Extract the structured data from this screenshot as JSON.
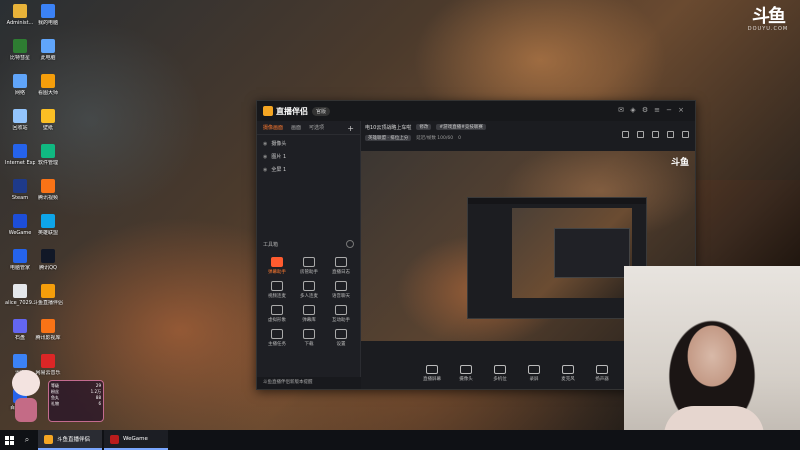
{
  "desktop": {
    "watermark": {
      "mark": "斗鱼",
      "sub": "DOUYU.COM"
    },
    "icons": [
      {
        "label": "Administ...",
        "color": "#e8b339"
      },
      {
        "label": "我的电脑",
        "color": "#3b82f6"
      },
      {
        "label": "比特彗星",
        "color": "#2e7d32"
      },
      {
        "label": "此电脑",
        "color": "#60a5fa"
      },
      {
        "label": "网络",
        "color": "#60a5fa"
      },
      {
        "label": "看图大师",
        "color": "#f59e0b"
      },
      {
        "label": "回收站",
        "color": "#93c5fd"
      },
      {
        "label": "壁纸",
        "color": "#fbbf24"
      },
      {
        "label": "Internet Explorer",
        "color": "#2563eb"
      },
      {
        "label": "软件管理",
        "color": "#10b981"
      },
      {
        "label": "Steam",
        "color": "#1e3a8a"
      },
      {
        "label": "腾讯视频",
        "color": "#f97316"
      },
      {
        "label": "WeGame",
        "color": "#1d4ed8"
      },
      {
        "label": "英雄联盟",
        "color": "#0ea5e9"
      },
      {
        "label": "电脑管家",
        "color": "#2563eb"
      },
      {
        "label": "腾讯QQ",
        "color": "#111827"
      },
      {
        "label": "alice_7029...",
        "color": "#e5e7eb"
      },
      {
        "label": "斗鱼直播伴侣",
        "color": "#f59e0b"
      },
      {
        "label": "石盘",
        "color": "#6366f1"
      },
      {
        "label": "腾讯影视库",
        "color": "#f97316"
      },
      {
        "label": "迅雷",
        "color": "#3b82f6"
      },
      {
        "label": "网易云音乐",
        "color": "#dc2626"
      },
      {
        "label": "百度网盘",
        "color": "#2563eb"
      }
    ]
  },
  "app": {
    "title": "直播伴侣",
    "version": "官版",
    "left_tabs": [
      {
        "label": "摄像画面",
        "active": true
      },
      {
        "label": "画面",
        "active": false
      },
      {
        "label": "可选项",
        "active": false
      }
    ],
    "add_label": "+",
    "sources": [
      {
        "label": "摄像头"
      },
      {
        "label": "图片 1"
      },
      {
        "label": "全屏 1"
      }
    ],
    "tools_title": "工具箱",
    "tools": [
      {
        "label": "弹幕助手",
        "hot": true
      },
      {
        "label": "房管助手",
        "hot": false
      },
      {
        "label": "直播日志",
        "hot": false
      },
      {
        "label": "视频连麦",
        "hot": false
      },
      {
        "label": "多人连麦",
        "hot": false
      },
      {
        "label": "语音聊天",
        "hot": false
      },
      {
        "label": "虚拟形象",
        "hot": false
      },
      {
        "label": "弹幕库",
        "hot": false
      },
      {
        "label": "互动助手",
        "hot": false
      },
      {
        "label": "主播任务",
        "hot": false
      },
      {
        "label": "下载",
        "hot": false
      },
      {
        "label": "设置",
        "hot": false
      }
    ],
    "bottom_notice": "斗鱼直播伴侣新版本提醒",
    "room": {
      "title": "电10云顶战略上车啦",
      "tag1": "修改",
      "tag2": "#游戏直播#竞技联赛",
      "category": "英雄联盟 · 排位上分",
      "ping": "延迟/帧数 100/60",
      "count": "0"
    },
    "preview_logo": "斗鱼",
    "bottom_actions": [
      {
        "label": "直播屏幕"
      },
      {
        "label": "摄像头"
      },
      {
        "label": "多机位"
      },
      {
        "label": "录屏"
      },
      {
        "label": "麦克风"
      },
      {
        "label": "扬声器"
      }
    ]
  },
  "mascot_card": {
    "rows": [
      [
        "等级",
        "29"
      ],
      [
        "粉丝",
        "1.2万"
      ],
      [
        "鱼丸",
        "88"
      ],
      [
        "礼物",
        "6"
      ]
    ]
  },
  "taskbar": {
    "items": [
      {
        "label": "斗鱼直播伴侣",
        "active": true
      },
      {
        "label": "WeGame",
        "active": false
      }
    ]
  }
}
